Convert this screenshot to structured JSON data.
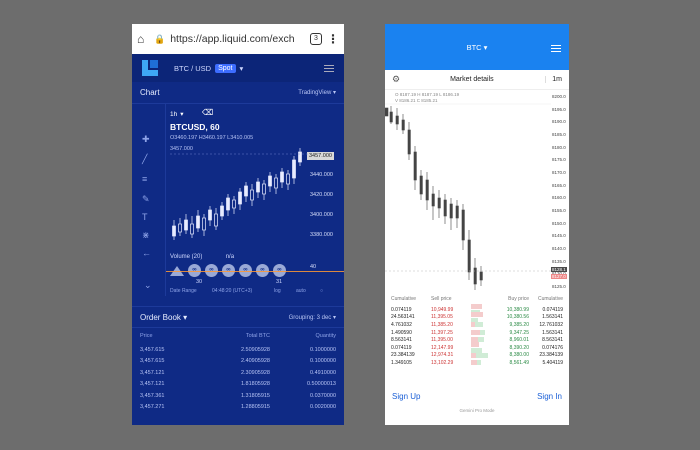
{
  "left_phone": {
    "browser": {
      "url": "https://app.liquid.com/exch",
      "tab_count": "3"
    },
    "header": {
      "pair": "BTC / USD",
      "market_type": "Spot"
    },
    "chart_panel": {
      "title": "Chart",
      "library": "TradingView",
      "interval": "1h",
      "symbol": "BTCUSD, 60",
      "ohlc": "O3460.197 H3460.197 L3410.005",
      "volume_line": "3457.000",
      "last_price": "3457.000",
      "y_ticks": [
        "3440.000",
        "3420.000",
        "3400.000",
        "3380.000"
      ],
      "volume_label": "Volume (20)",
      "volume_value": "n/a",
      "x_ticks": [
        "30",
        "31"
      ],
      "footer_left": "Date Range",
      "footer_time": "04:48:20 (UTC+3)",
      "footer_log": "log",
      "footer_auto": "auto",
      "side_tick": "40"
    },
    "order_book": {
      "title": "Order Book",
      "grouping": "Grouping: 3 dec",
      "columns": [
        "Price",
        "Total BTC",
        "Quantity"
      ],
      "rows": [
        [
          "3,457.615",
          "2.50905928",
          "0.1000000"
        ],
        [
          "3,457.615",
          "2.40905928",
          "0.1000000"
        ],
        [
          "3,457.121",
          "2.30905928",
          "0.4910000"
        ],
        [
          "3,457.121",
          "1.81805928",
          "0.50000013"
        ],
        [
          "3,457.361",
          "1.31805915",
          "0.0370000"
        ],
        [
          "3,457.271",
          "1.28805915",
          "0.0020000"
        ]
      ]
    }
  },
  "right_phone": {
    "header": {
      "pair": "BTC"
    },
    "market_details": {
      "title": "Market details",
      "timeframe": "1m"
    },
    "chart": {
      "info_line_1": "O 8187.19  H 8187.19  L 8186.19",
      "info_line_2": "V 8186.21  C 8185.21",
      "y_ticks": [
        "8200.0",
        "8195.0",
        "8190.0",
        "8185.0",
        "8180.0",
        "8175.0",
        "8170.0",
        "8165.0",
        "8160.0",
        "8155.0",
        "8150.0",
        "8145.0",
        "8140.0",
        "8135.0",
        "8130.0",
        "8125.0"
      ],
      "last_price": "8128.1",
      "last_price2": "8127.0"
    },
    "depth": {
      "columns": [
        "Cumulative",
        "Sell price",
        "",
        "Buy price",
        "Cumulative"
      ],
      "rows": [
        [
          "0.074119",
          "10,949.99",
          "",
          "10,380.99",
          "0.074119"
        ],
        [
          "24.563141",
          "11,395.05",
          "",
          "10,380.56",
          "1.563141"
        ],
        [
          "4.761032",
          "11,385.20",
          "",
          "9,385.20",
          "12.761032"
        ],
        [
          "1.490590",
          "11,397.25",
          "",
          "9,347.25",
          "1.563141"
        ],
        [
          "8.563141",
          "11,395.00",
          "",
          "8,960.01",
          "8.563141"
        ],
        [
          "0.074119",
          "12,147.99",
          "",
          "8,390.20",
          "0.074176"
        ],
        [
          "23.384139",
          "12,974.31",
          "",
          "8,380.00",
          "23.384139"
        ],
        [
          "1.349105",
          "13,102.29",
          "",
          "8,561.49",
          "5.404119"
        ]
      ]
    },
    "footer": {
      "sign_up": "Sign Up",
      "sign_in": "Sign In",
      "powered": "Gemini Pro Mode"
    }
  }
}
